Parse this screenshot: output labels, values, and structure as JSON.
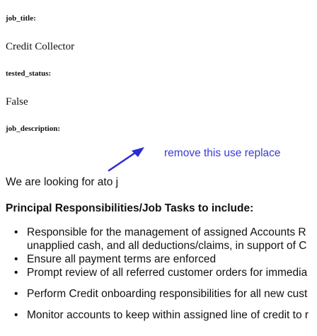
{
  "fields": {
    "job_title_label": "job_title:",
    "job_title_value": "Credit Collector",
    "tested_status_label": "tested_status:",
    "tested_status_value": "False",
    "job_description_label": "job_description:"
  },
  "annotation": {
    "text": "remove this use replace",
    "color": "#3a39d8",
    "icon": "arrow-icon"
  },
  "description": {
    "intro": "We are looking for ato j",
    "heading": "Principal Responsibilities/Job Tasks to include:",
    "bullets": [
      {
        "line1": "Responsible for the management of assigned Accounts R",
        "line2": "unapplied cash, and all deductions/claims, in support of C"
      },
      {
        "line1": "Ensure all payment terms are enforced"
      },
      {
        "line1": "Prompt review of all referred customer orders for immedia"
      },
      {
        "line1": "Perform Credit onboarding responsibilities for all new cust"
      },
      {
        "line1": "Monitor accounts to keep within assigned line of credit to r"
      }
    ]
  }
}
